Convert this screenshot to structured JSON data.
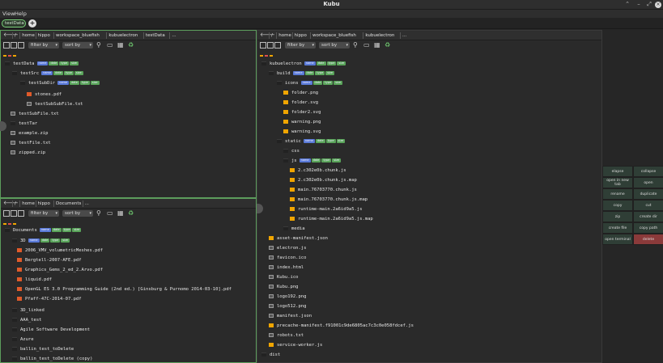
{
  "window": {
    "title": "Kubu"
  },
  "menu": {
    "view": "View",
    "help": "Help"
  },
  "tabs": {
    "active": "testData",
    "add": "+"
  },
  "toolbar": {
    "filter": "filter by",
    "sort": "sort by"
  },
  "pane_top_left": {
    "crumbs": [
      "/",
      "home",
      "hippo",
      "workspace_bluefish",
      "kubuelectron",
      "testData",
      "..."
    ],
    "rows": [
      {
        "name": "testData",
        "tags": [
          "name",
          "date",
          "type",
          "size"
        ]
      },
      {
        "name": "testSrc",
        "tags": [
          "name",
          "date",
          "type",
          "size"
        ]
      },
      {
        "name": "testSubDir",
        "tags": [
          "name",
          "date",
          "type",
          "size"
        ]
      },
      {
        "name": "stones.pdf",
        "tags": []
      },
      {
        "name": "testSubSubFile.txt",
        "tags": []
      },
      {
        "name": "testSubFile.txt",
        "tags": []
      },
      {
        "name": "testTar",
        "tags": []
      },
      {
        "name": "example.zip",
        "tags": []
      },
      {
        "name": "testFile.txt",
        "tags": []
      },
      {
        "name": "zipped.zip",
        "tags": []
      }
    ]
  },
  "pane_bottom_left": {
    "crumbs": [
      "/",
      "home",
      "hippo",
      "Documents",
      "..."
    ],
    "rows": [
      {
        "name": "Documents",
        "tags": [
          "name",
          "date",
          "type",
          "size"
        ]
      },
      {
        "name": "3D",
        "tags": [
          "name",
          "date",
          "type",
          "size"
        ]
      },
      {
        "name": "2006_VMV_volumetricMeshes.pdf",
        "tags": []
      },
      {
        "name": "Bergtell-2007-AFE.pdf",
        "tags": []
      },
      {
        "name": "Graphics_Gems_2_ed_2.Arvo.pdf",
        "tags": []
      },
      {
        "name": "liquid.pdf",
        "tags": []
      },
      {
        "name": "OpenGL ES 3.0 Programming Guide (2nd ed.) [Ginsburg & Purnomo 2014-03-10].pdf",
        "tags": []
      },
      {
        "name": "Pfaff-47C-2014-07.pdf",
        "tags": []
      },
      {
        "name": "3D_linked",
        "tags": []
      },
      {
        "name": "AAA_test",
        "tags": []
      },
      {
        "name": "Agile Software Development",
        "tags": []
      },
      {
        "name": "Azure",
        "tags": []
      },
      {
        "name": "ballin_test_toDelete",
        "tags": []
      },
      {
        "name": "ballin_test_toDelete (copy)",
        "tags": []
      }
    ]
  },
  "pane_right": {
    "crumbs": [
      "/",
      "home",
      "hippo",
      "workspace_bluefish",
      "kubuelectron",
      "..."
    ],
    "rows": [
      {
        "name": "kubuelectron",
        "tags": [
          "name",
          "date",
          "type",
          "size"
        ]
      },
      {
        "name": "build",
        "tags": [
          "name",
          "date",
          "type",
          "size"
        ]
      },
      {
        "name": "icons",
        "tags": [
          "name",
          "date",
          "type",
          "size"
        ]
      },
      {
        "name": "folder.png",
        "tags": []
      },
      {
        "name": "folder.svg",
        "tags": []
      },
      {
        "name": "folder2.svg",
        "tags": []
      },
      {
        "name": "warning.png",
        "tags": []
      },
      {
        "name": "warning.svg",
        "tags": []
      },
      {
        "name": "static",
        "tags": [
          "name",
          "date",
          "type",
          "size"
        ]
      },
      {
        "name": "css",
        "tags": []
      },
      {
        "name": "js",
        "tags": [
          "name",
          "date",
          "type",
          "size"
        ]
      },
      {
        "name": "2.c302e0b.chunk.js",
        "tags": []
      },
      {
        "name": "2.c302e0b.chunk.js.map",
        "tags": []
      },
      {
        "name": "main.76703770.chunk.js",
        "tags": []
      },
      {
        "name": "main.76703770.chunk.js.map",
        "tags": []
      },
      {
        "name": "runtime-main.2a6id9a5.js",
        "tags": []
      },
      {
        "name": "runtime-main.2a6id9a5.js.map",
        "tags": []
      },
      {
        "name": "media",
        "tags": []
      },
      {
        "name": "asset-manifest.json",
        "tags": []
      },
      {
        "name": "electron.js",
        "tags": []
      },
      {
        "name": "favicon.ico",
        "tags": []
      },
      {
        "name": "index.html",
        "tags": []
      },
      {
        "name": "Kubu.ico",
        "tags": []
      },
      {
        "name": "Kubu.png",
        "tags": []
      },
      {
        "name": "logo192.png",
        "tags": []
      },
      {
        "name": "logo512.png",
        "tags": []
      },
      {
        "name": "manifest.json",
        "tags": []
      },
      {
        "name": "precache-manifest.f91001c9de6805ac7c3c0e058fdcef.js",
        "tags": []
      },
      {
        "name": "robots.txt",
        "tags": []
      },
      {
        "name": "service-worker.js",
        "tags": []
      },
      {
        "name": "dist",
        "tags": []
      }
    ]
  },
  "actions": [
    "elapse",
    "collapse",
    "open in new tab",
    "open",
    "rename",
    "duplicate",
    "copy",
    "cut",
    "zip",
    "create dir",
    "create file",
    "copy path",
    "open terminal",
    "delete"
  ]
}
